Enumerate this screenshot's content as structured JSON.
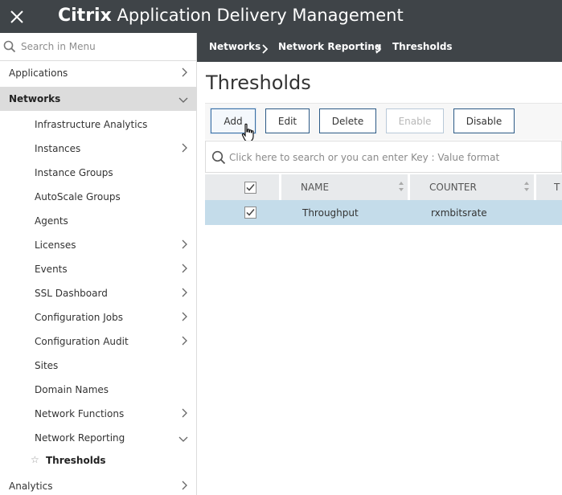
{
  "app": {
    "brand_bold": "Citrix",
    "brand_rest": "Application Delivery Management"
  },
  "sidebar": {
    "search_placeholder": "Search in Menu",
    "items": [
      {
        "label": "Applications"
      },
      {
        "label": "Networks"
      },
      {
        "label": "Infrastructure Analytics"
      },
      {
        "label": "Instances"
      },
      {
        "label": "Instance Groups"
      },
      {
        "label": "AutoScale Groups"
      },
      {
        "label": "Agents"
      },
      {
        "label": "Licenses"
      },
      {
        "label": "Events"
      },
      {
        "label": "SSL Dashboard"
      },
      {
        "label": "Configuration Jobs"
      },
      {
        "label": "Configuration Audit"
      },
      {
        "label": "Sites"
      },
      {
        "label": "Domain Names"
      },
      {
        "label": "Network Functions"
      },
      {
        "label": "Network Reporting"
      },
      {
        "label": "Thresholds"
      },
      {
        "label": "Analytics"
      }
    ]
  },
  "breadcrumb": [
    "Networks",
    "Network Reporting",
    "Thresholds"
  ],
  "page": {
    "title": "Thresholds"
  },
  "toolbar": {
    "add": "Add",
    "edit": "Edit",
    "delete": "Delete",
    "enable": "Enable",
    "disable": "Disable"
  },
  "table": {
    "search_placeholder": "Click here to search or you can enter Key : Value format",
    "columns": [
      "NAME",
      "COUNTER",
      "T"
    ],
    "rows": [
      {
        "name": "Throughput",
        "counter": "rxmbitsrate",
        "selected": true
      }
    ]
  },
  "colors": {
    "header_bg": "#3f4448",
    "active_nav": "#dcdcdc",
    "selected_row": "#c4dcea",
    "button_border": "#2c5a86"
  }
}
